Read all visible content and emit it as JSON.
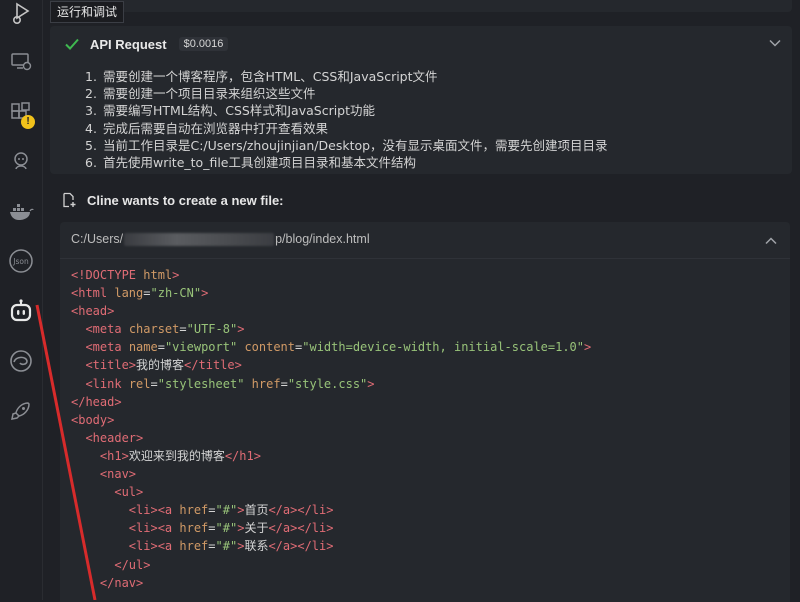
{
  "activity_bar": {
    "tooltip": "运行和调试",
    "icons": [
      "run-debug-icon",
      "remote-explorer-icon",
      "extensions-icon",
      "github-icon",
      "docker-icon",
      "json-icon",
      "cline-icon",
      "edge-icon",
      "rocket-icon"
    ],
    "extensions_badge": "!",
    "json_label": "Json"
  },
  "api_request": {
    "title": "API Request",
    "cost": "$0.0016",
    "items": [
      "需要创建一个博客程序，包含HTML、CSS和JavaScript文件",
      "需要创建一个项目目录来组织这些文件",
      "需要编写HTML结构、CSS样式和JavaScript功能",
      "完成后需要自动在浏览器中打开查看效果",
      "当前工作目录是C:/Users/zhoujinjian/Desktop，没有显示桌面文件，需要先创建项目目录",
      "首先使用write_to_file工具创建项目目录和基本文件结构"
    ]
  },
  "file_notice": {
    "text": "Cline wants to create a new file:"
  },
  "file_card": {
    "path_prefix": "C:/Users/",
    "path_suffix": "p/blog/index.html",
    "code_lines": [
      [
        {
          "t": "tag",
          "v": "<!DOCTYPE "
        },
        {
          "t": "attr",
          "v": "html"
        },
        {
          "t": "tag",
          "v": ">"
        }
      ],
      [
        {
          "t": "tag",
          "v": "<html "
        },
        {
          "t": "attr",
          "v": "lang"
        },
        {
          "t": "text",
          "v": "="
        },
        {
          "t": "str",
          "v": "\"zh-CN\""
        },
        {
          "t": "tag",
          "v": ">"
        }
      ],
      [
        {
          "t": "tag",
          "v": "<head>"
        }
      ],
      [
        {
          "t": "text",
          "v": "  "
        },
        {
          "t": "tag",
          "v": "<meta "
        },
        {
          "t": "attr",
          "v": "charset"
        },
        {
          "t": "text",
          "v": "="
        },
        {
          "t": "str",
          "v": "\"UTF-8\""
        },
        {
          "t": "tag",
          "v": ">"
        }
      ],
      [
        {
          "t": "text",
          "v": "  "
        },
        {
          "t": "tag",
          "v": "<meta "
        },
        {
          "t": "attr",
          "v": "name"
        },
        {
          "t": "text",
          "v": "="
        },
        {
          "t": "str",
          "v": "\"viewport\""
        },
        {
          "t": "text",
          "v": " "
        },
        {
          "t": "attr",
          "v": "content"
        },
        {
          "t": "text",
          "v": "="
        },
        {
          "t": "str",
          "v": "\"width=device-width, initial-scale=1.0\""
        },
        {
          "t": "tag",
          "v": ">"
        }
      ],
      [
        {
          "t": "text",
          "v": "  "
        },
        {
          "t": "tag",
          "v": "<title>"
        },
        {
          "t": "text",
          "v": "我的博客"
        },
        {
          "t": "tag",
          "v": "</title>"
        }
      ],
      [
        {
          "t": "text",
          "v": "  "
        },
        {
          "t": "tag",
          "v": "<link "
        },
        {
          "t": "attr",
          "v": "rel"
        },
        {
          "t": "text",
          "v": "="
        },
        {
          "t": "str",
          "v": "\"stylesheet\""
        },
        {
          "t": "text",
          "v": " "
        },
        {
          "t": "attr",
          "v": "href"
        },
        {
          "t": "text",
          "v": "="
        },
        {
          "t": "str",
          "v": "\"style.css\""
        },
        {
          "t": "tag",
          "v": ">"
        }
      ],
      [
        {
          "t": "tag",
          "v": "</head>"
        }
      ],
      [
        {
          "t": "tag",
          "v": "<body>"
        }
      ],
      [
        {
          "t": "text",
          "v": "  "
        },
        {
          "t": "tag",
          "v": "<header>"
        }
      ],
      [
        {
          "t": "text",
          "v": "    "
        },
        {
          "t": "tag",
          "v": "<h1>"
        },
        {
          "t": "text",
          "v": "欢迎来到我的博客"
        },
        {
          "t": "tag",
          "v": "</h1>"
        }
      ],
      [
        {
          "t": "text",
          "v": "    "
        },
        {
          "t": "tag",
          "v": "<nav>"
        }
      ],
      [
        {
          "t": "text",
          "v": "      "
        },
        {
          "t": "tag",
          "v": "<ul>"
        }
      ],
      [
        {
          "t": "text",
          "v": "        "
        },
        {
          "t": "tag",
          "v": "<li><a "
        },
        {
          "t": "attr",
          "v": "href"
        },
        {
          "t": "text",
          "v": "="
        },
        {
          "t": "str",
          "v": "\"#\""
        },
        {
          "t": "tag",
          "v": ">"
        },
        {
          "t": "text",
          "v": "首页"
        },
        {
          "t": "tag",
          "v": "</a></li>"
        }
      ],
      [
        {
          "t": "text",
          "v": "        "
        },
        {
          "t": "tag",
          "v": "<li><a "
        },
        {
          "t": "attr",
          "v": "href"
        },
        {
          "t": "text",
          "v": "="
        },
        {
          "t": "str",
          "v": "\"#\""
        },
        {
          "t": "tag",
          "v": ">"
        },
        {
          "t": "text",
          "v": "关于"
        },
        {
          "t": "tag",
          "v": "</a></li>"
        }
      ],
      [
        {
          "t": "text",
          "v": "        "
        },
        {
          "t": "tag",
          "v": "<li><a "
        },
        {
          "t": "attr",
          "v": "href"
        },
        {
          "t": "text",
          "v": "="
        },
        {
          "t": "str",
          "v": "\"#\""
        },
        {
          "t": "tag",
          "v": ">"
        },
        {
          "t": "text",
          "v": "联系"
        },
        {
          "t": "tag",
          "v": "</a></li>"
        }
      ],
      [
        {
          "t": "text",
          "v": "      "
        },
        {
          "t": "tag",
          "v": "</ul>"
        }
      ],
      [
        {
          "t": "text",
          "v": "    "
        },
        {
          "t": "tag",
          "v": "</nav>"
        }
      ]
    ]
  },
  "colors": {
    "background": "#1f2126",
    "card": "#25282d",
    "check": "#3fb950",
    "tag": "#e06c75",
    "attr": "#d19a66",
    "string": "#98c379",
    "annotation": "#d72b2b",
    "warning": "#f1c21b"
  }
}
